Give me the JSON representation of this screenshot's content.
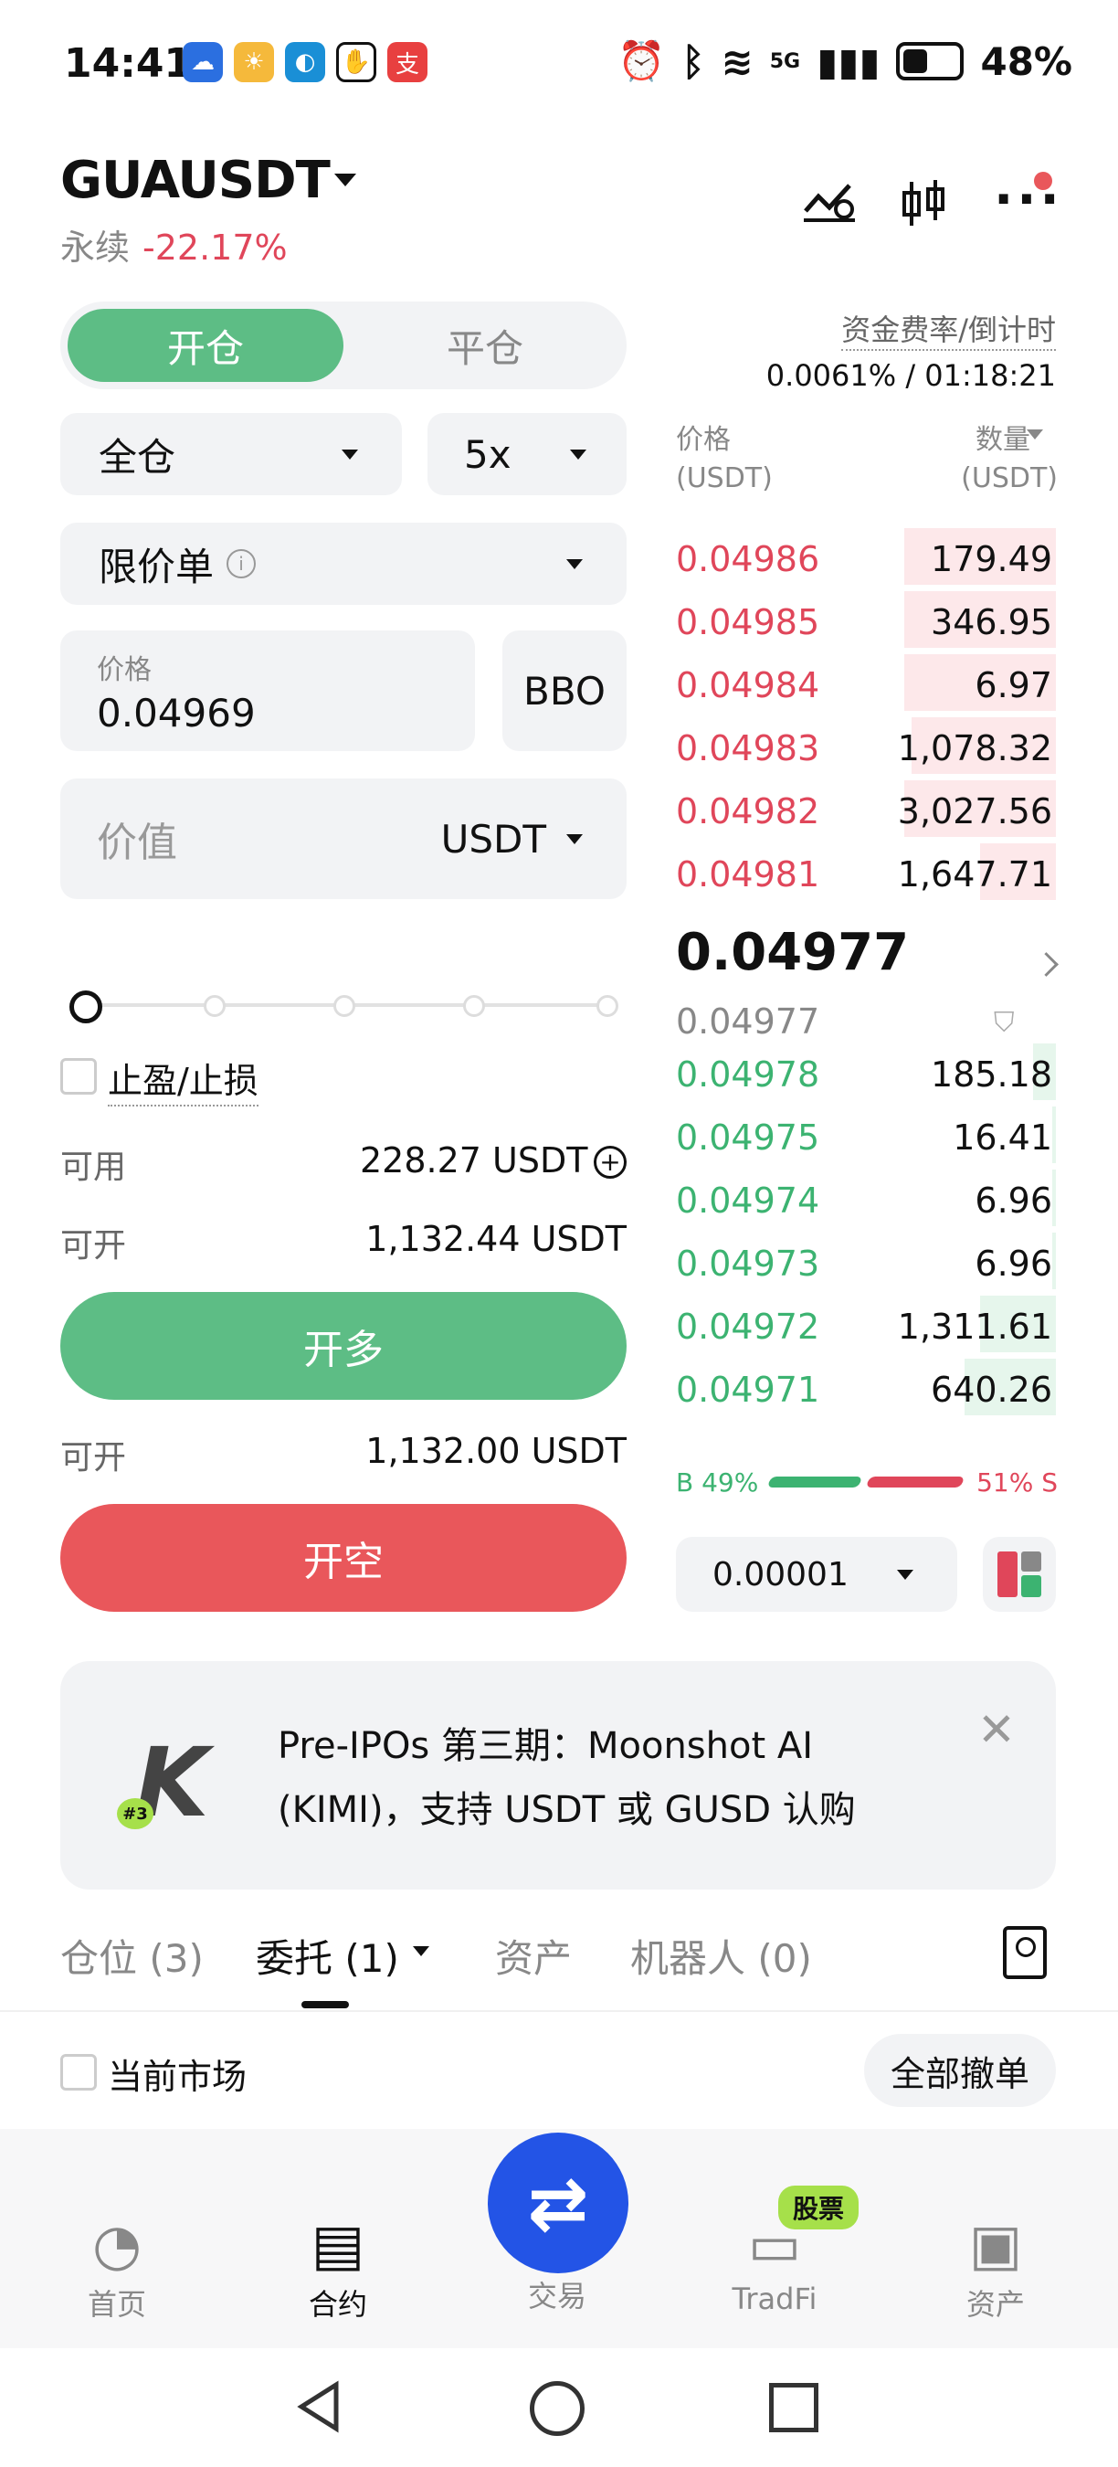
{
  "status": {
    "time": "14:41",
    "battery": "48%",
    "network": "5G"
  },
  "header": {
    "pair": "GUAUSDT",
    "contract_type": "永续",
    "change": "-22.17%"
  },
  "mode_tabs": {
    "open": "开仓",
    "close": "平仓"
  },
  "margin": {
    "mode": "全仓",
    "leverage": "5x"
  },
  "order_type": "限价单",
  "price": {
    "label": "价格",
    "value": "0.04969",
    "bbo": "BBO"
  },
  "value": {
    "placeholder": "价值",
    "unit": "USDT"
  },
  "tpsl": "止盈/止损",
  "available": {
    "label": "可用",
    "value": "228.27 USDT"
  },
  "can_open_long": {
    "label": "可开",
    "value": "1,132.44 USDT"
  },
  "open_long": "开多",
  "can_open_short": {
    "label": "可开",
    "value": "1,132.00 USDT"
  },
  "open_short": "开空",
  "funding": {
    "label": "资金费率/倒计时",
    "value": "0.0061% / 01:18:21"
  },
  "orderbook": {
    "price_header": "价格",
    "price_unit": "(USDT)",
    "qty_header": "数量",
    "qty_unit": "(USDT)",
    "asks": [
      {
        "price": "0.04986",
        "qty": "179.49",
        "depth": 0.4
      },
      {
        "price": "0.04985",
        "qty": "346.95",
        "depth": 0.4
      },
      {
        "price": "0.04984",
        "qty": "6.97",
        "depth": 0.4
      },
      {
        "price": "0.04983",
        "qty": "1,078.32",
        "depth": 0.38
      },
      {
        "price": "0.04982",
        "qty": "3,027.56",
        "depth": 0.4
      },
      {
        "price": "0.04981",
        "qty": "1,647.71",
        "depth": 0.2
      }
    ],
    "last_price": "0.04977",
    "mark_price": "0.04977",
    "bids": [
      {
        "price": "0.04978",
        "qty": "185.18",
        "depth": 0.06
      },
      {
        "price": "0.04975",
        "qty": "16.41",
        "depth": 0.01
      },
      {
        "price": "0.04974",
        "qty": "6.96",
        "depth": 0.01
      },
      {
        "price": "0.04973",
        "qty": "6.96",
        "depth": 0.01
      },
      {
        "price": "0.04972",
        "qty": "1,311.61",
        "depth": 0.2
      },
      {
        "price": "0.04971",
        "qty": "640.26",
        "depth": 0.24
      }
    ],
    "buy_ratio": "B 49%",
    "sell_ratio": "51% S",
    "buy_pct": 49,
    "precision": "0.00001"
  },
  "banner": {
    "line1": "Pre-IPOs 第三期：Moonshot AI",
    "line2": "(KIMI)，支持 USDT 或 GUSD 认购",
    "badge": "#3"
  },
  "bottom_tabs": [
    {
      "label": "仓位 (3)"
    },
    {
      "label": "委托 (1)"
    },
    {
      "label": "资产"
    },
    {
      "label": "机器人 (0)"
    }
  ],
  "current_market": "当前市场",
  "cancel_all": "全部撤单",
  "nav": [
    {
      "label": "首页"
    },
    {
      "label": "合约"
    },
    {
      "label": "交易"
    },
    {
      "label": "TradFi",
      "badge": "股票"
    },
    {
      "label": "资产"
    }
  ],
  "colors": {
    "green": "#5dbd85",
    "red": "#e9575b",
    "blue": "#2354e6"
  }
}
